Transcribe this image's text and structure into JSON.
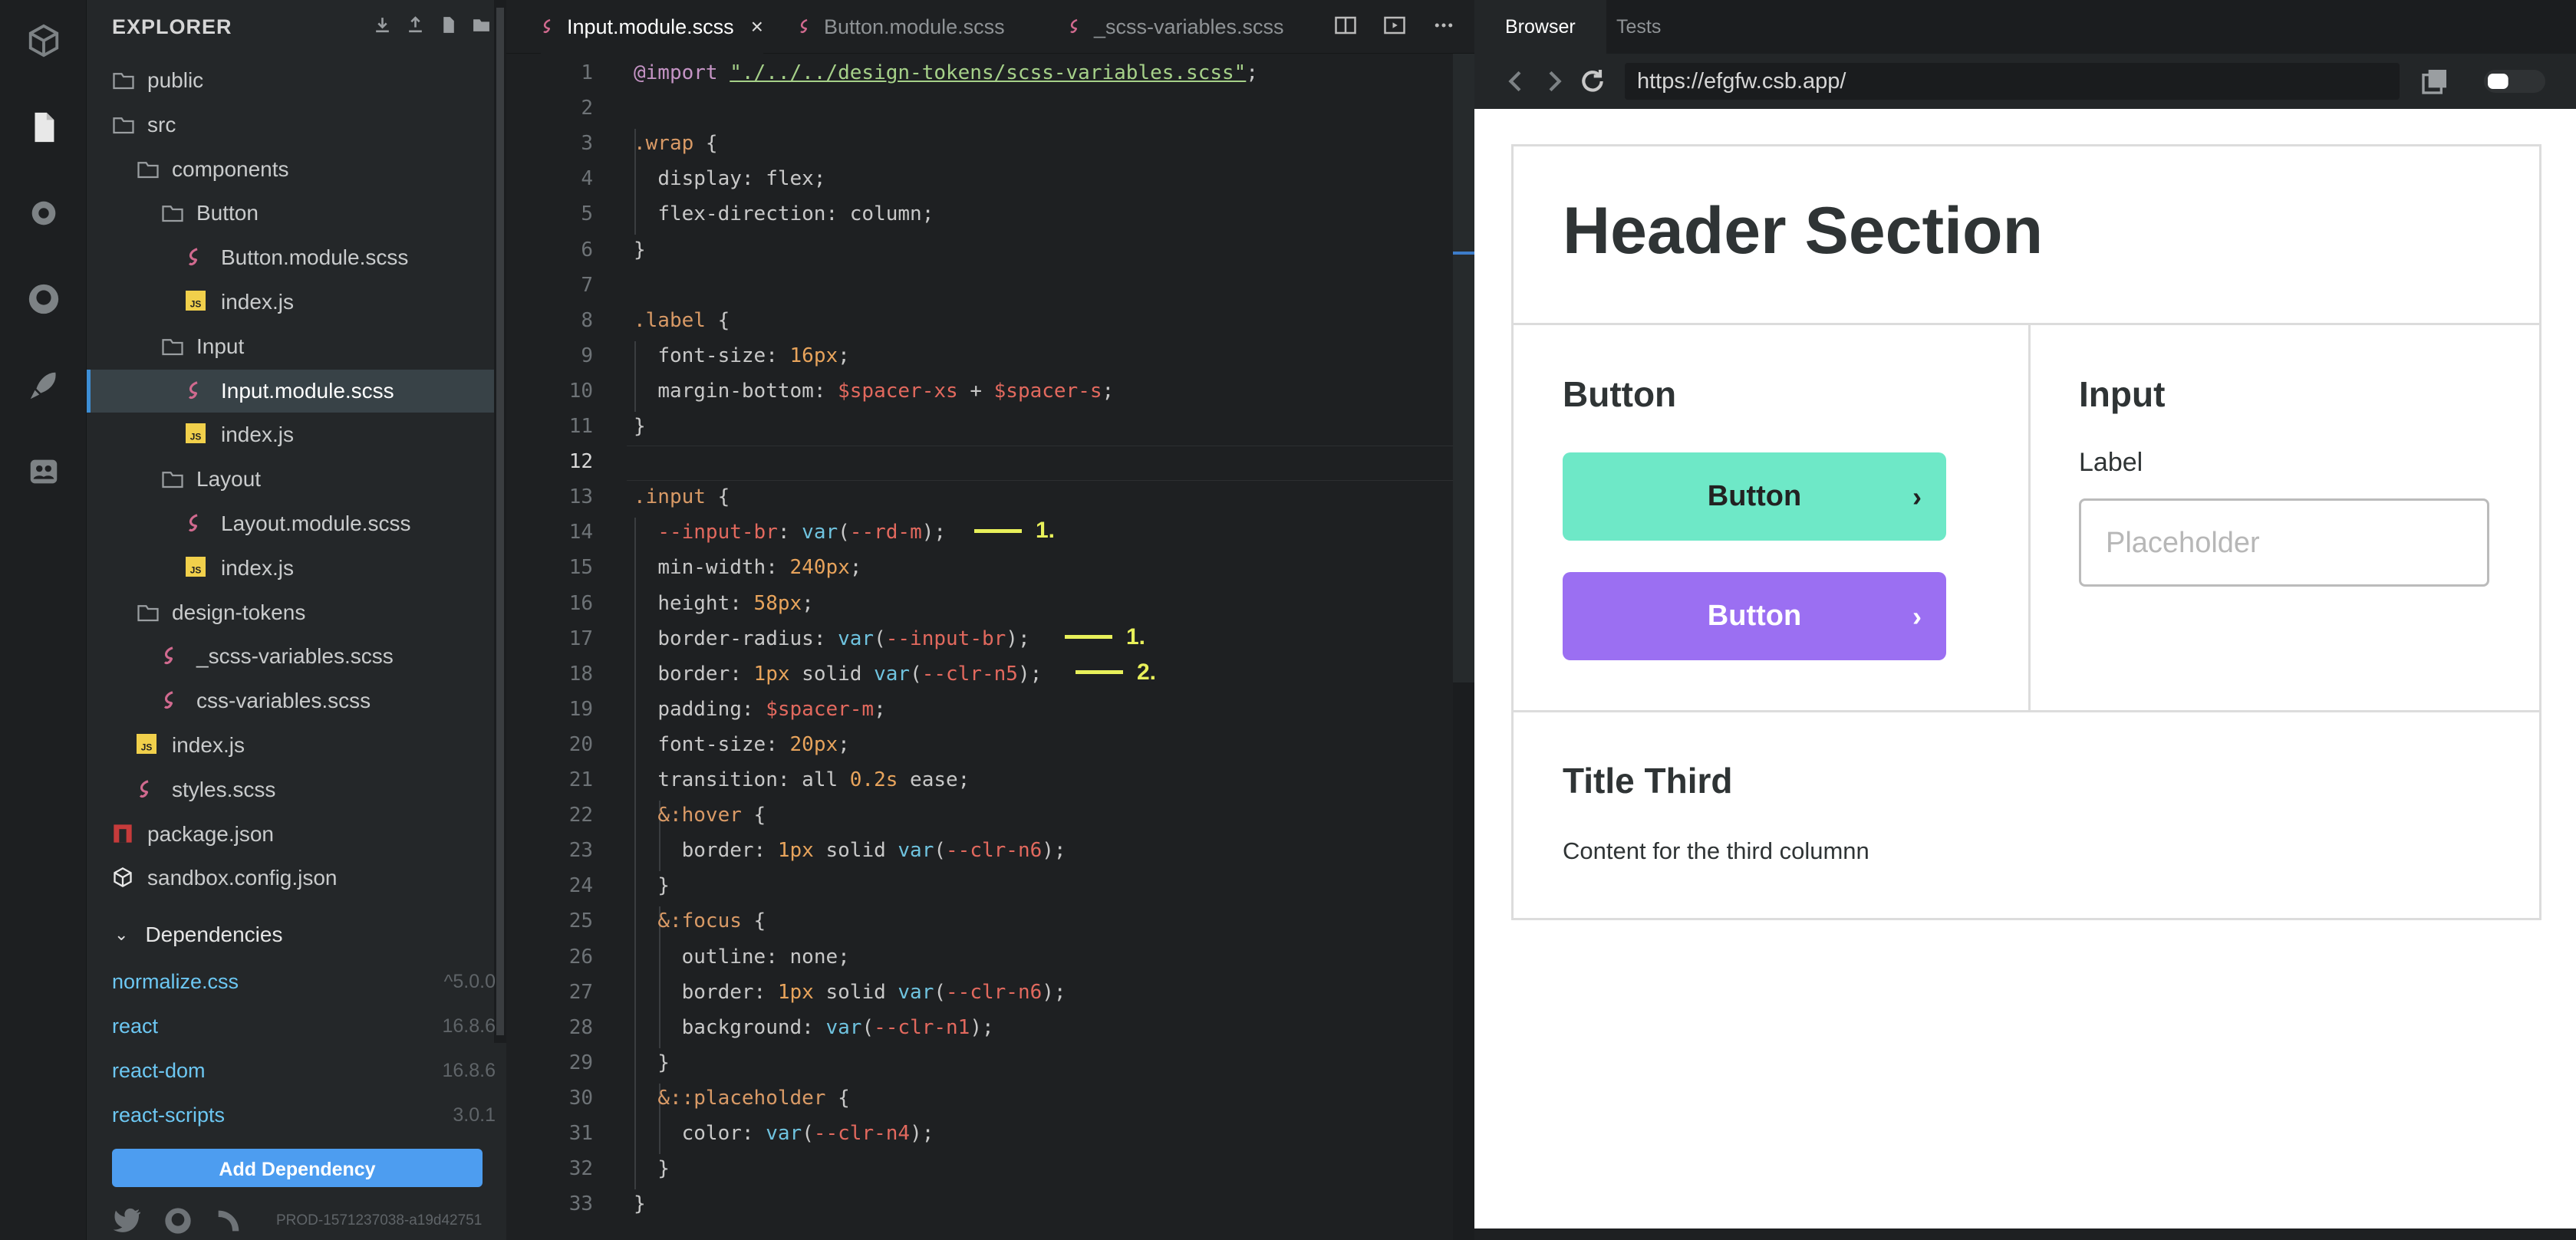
{
  "activity_bar": {
    "icons": [
      "sandbox-cube-icon",
      "file-icon",
      "gear-icon",
      "github-icon",
      "rocket-icon",
      "users-icon"
    ]
  },
  "explorer": {
    "title": "EXPLORER",
    "tree": [
      {
        "label": "public",
        "icon": "folder-icon"
      },
      {
        "label": "src",
        "icon": "folder-icon"
      },
      {
        "label": "components",
        "icon": "folder-icon"
      },
      {
        "label": "Button",
        "icon": "folder-icon"
      },
      {
        "label": "Button.module.scss",
        "icon": "sass-icon"
      },
      {
        "label": "index.js",
        "icon": "js-icon"
      },
      {
        "label": "Input",
        "icon": "folder-icon"
      },
      {
        "label": "Input.module.scss",
        "icon": "sass-icon",
        "active": true
      },
      {
        "label": "index.js",
        "icon": "js-icon"
      },
      {
        "label": "Layout",
        "icon": "folder-icon"
      },
      {
        "label": "Layout.module.scss",
        "icon": "sass-icon"
      },
      {
        "label": "index.js",
        "icon": "js-icon"
      },
      {
        "label": "design-tokens",
        "icon": "folder-icon"
      },
      {
        "label": "_scss-variables.scss",
        "icon": "sass-icon"
      },
      {
        "label": "css-variables.scss",
        "icon": "sass-icon"
      },
      {
        "label": "index.js",
        "icon": "js-icon"
      },
      {
        "label": "styles.scss",
        "icon": "sass-icon"
      },
      {
        "label": "package.json",
        "icon": "npm-icon"
      },
      {
        "label": "sandbox.config.json",
        "icon": "cube-icon"
      }
    ],
    "dependencies_title": "Dependencies",
    "dependencies": [
      {
        "name": "normalize.css",
        "version": "^5.0.0"
      },
      {
        "name": "react",
        "version": "16.8.6"
      },
      {
        "name": "react-dom",
        "version": "16.8.6"
      },
      {
        "name": "react-scripts",
        "version": "3.0.1"
      }
    ],
    "add_dependency": "Add Dependency",
    "build_version": "PROD-1571237038-a19d42751"
  },
  "editor": {
    "tabs": [
      {
        "label": "Input.module.scss",
        "active": true
      },
      {
        "label": "Button.module.scss"
      },
      {
        "label": "_scss-variables.scss"
      }
    ],
    "close_glyph": "×",
    "current_line": 12,
    "lines": [
      "@import \"./../../design-tokens/scss-variables.scss\";",
      "",
      ".wrap {",
      "  display: flex;",
      "  flex-direction: column;",
      "}",
      "",
      ".label {",
      "  font-size: 16px;",
      "  margin-bottom: $spacer-xs + $spacer-s;",
      "}",
      "",
      ".input {",
      "  --input-br: var(--rd-m);",
      "  min-width: 240px;",
      "  height: 58px;",
      "  border-radius: var(--input-br);",
      "  border: 1px solid var(--clr-n5);",
      "  padding: $spacer-m;",
      "  font-size: 20px;",
      "  transition: all 0.2s ease;",
      "  &:hover {",
      "    border: 1px solid var(--clr-n6);",
      "  }",
      "  &:focus {",
      "    outline: none;",
      "    border: 1px solid var(--clr-n6);",
      "    background: var(--clr-n1);",
      "  }",
      "  &::placeholder {",
      "    color: var(--clr-n4);",
      "  }",
      "}"
    ],
    "annotations": [
      {
        "line": 14,
        "label": "1."
      },
      {
        "line": 17,
        "label": "1."
      },
      {
        "line": 18,
        "label": "2."
      }
    ]
  },
  "preview": {
    "tabs": [
      "Browser",
      "Tests"
    ],
    "url": "https://efgfw.csb.app/",
    "header": "Header Section",
    "col1_title": "Button",
    "button1": "Button",
    "button2": "Button",
    "col2_title": "Input",
    "input_label": "Label",
    "input_placeholder": "Placeholder",
    "col3_title": "Title Third",
    "col3_text": "Content for the third columnn",
    "colors": {
      "button1": "#6ee8c7",
      "button2": "#9b6ff2"
    }
  }
}
